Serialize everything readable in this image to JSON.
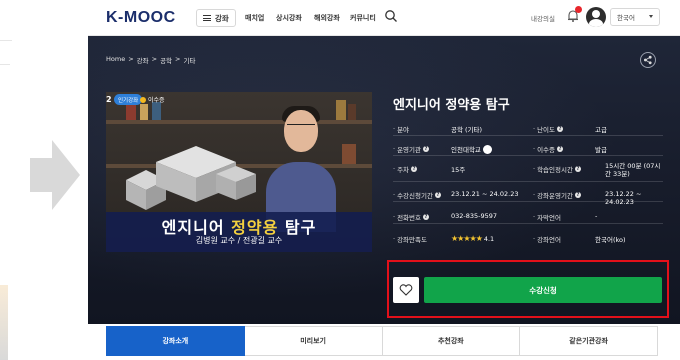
{
  "logo": "K-MOOC",
  "nav": {
    "menu_label": "강좌",
    "items": [
      "매치업",
      "상시강좌",
      "해외강좌",
      "커뮤니티"
    ],
    "lecture_room": "내강의실",
    "language": "한국어"
  },
  "breadcrumb": [
    "Home",
    "강좌",
    "공학",
    "기타"
  ],
  "thumbnail": {
    "number": "2",
    "popular_badge": "인기강좌",
    "cert_badge": "이수증",
    "title_plain_1": "엔지니어 ",
    "title_highlight": "정약용",
    "title_plain_2": " 탐구",
    "subtitle": "김병원 교수 / 전광길 교수"
  },
  "course": {
    "title": "엔지니어 정약용 탐구",
    "info": [
      {
        "label": "분야",
        "help": false,
        "value": "공학 (기타)"
      },
      {
        "label": "난이도",
        "help": true,
        "value": "고급"
      },
      {
        "label": "운영기관",
        "help": true,
        "value": "인천대학교"
      },
      {
        "label": "이수증",
        "help": true,
        "value": "발급"
      },
      {
        "label": "주차",
        "help": true,
        "value": "15주"
      },
      {
        "label": "학습인정시간",
        "help": true,
        "value": "15시간 00분 (07시간 33분)"
      },
      {
        "label": "수강신청기간",
        "help": true,
        "value": "23.12.21 ~ 24.02.23"
      },
      {
        "label": "강좌운영기간",
        "help": true,
        "value": "23.12.22 ~ 24.02.23"
      },
      {
        "label": "전화번호",
        "help": true,
        "value": "032-835-9597"
      },
      {
        "label": "자막언어",
        "help": false,
        "value": "-"
      },
      {
        "label": "강좌만족도",
        "help": false,
        "value": "4.1",
        "stars": "★★★★★"
      },
      {
        "label": "강좌언어",
        "help": false,
        "value": "한국어(ko)"
      }
    ],
    "enroll_label": "수강신청"
  },
  "tabs": [
    "강좌소개",
    "미리보기",
    "추천강좌",
    "같은기관강좌"
  ],
  "colors": {
    "enroll": "#11a44a",
    "tab_active": "#1762c9",
    "highlight_box": "#e3101a"
  }
}
